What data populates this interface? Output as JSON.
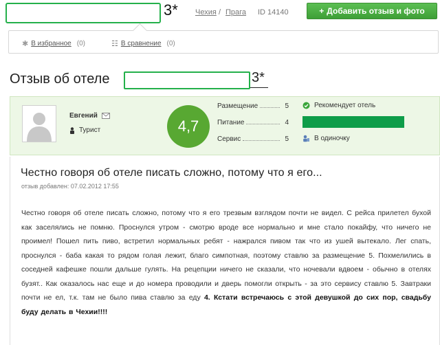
{
  "header": {
    "hotel_stars": "3*",
    "country": "Чехия",
    "separator": "/",
    "city": "Прага",
    "hotel_id": "ID 14140",
    "add_review_button": "Добавить отзыв и фото",
    "add_icon": "plus-icon"
  },
  "actions": {
    "favorites_label": "В избранное",
    "favorites_count": "(0)",
    "compare_label": "В сравнение",
    "compare_count": "(0)"
  },
  "title": {
    "prefix": "Отзыв об отеле",
    "stars": "3*"
  },
  "reviewer": {
    "name": "Евгений",
    "role": "Турист",
    "mail_icon": "envelope-icon",
    "role_icon": "person-icon",
    "avatar_icon": "user-silhouette-icon"
  },
  "score": "4,7",
  "ratings": [
    {
      "label": "Размещение",
      "value": "5"
    },
    {
      "label": "Питание",
      "value": "4"
    },
    {
      "label": "Сервис",
      "value": "5"
    }
  ],
  "recommend": "Рекомендует отель",
  "travel_type": "В одиночку",
  "colors": {
    "accent_green": "#58a832",
    "panel_bg": "#edf7e6",
    "highlight_bar": "#0e9d49"
  },
  "review": {
    "heading": "Честно говоря об отеле писать сложно, потому что я его...",
    "date": "отзыв добавлен: 07.02.2012 17:55",
    "body_before_bold": "Честно говоря об отеле писать сложно, потому что я его трезвым взглядом почти не видел. С рейса прилетел бухой как заселялись не помню. Проснулся утром - смотрю вроде все нормально и мне стало покайфу, что ничего не проимел! Пошел пить пиво, встретил нормальных ребят - нажрался пивом так что из ушей вытекало. Лег спать, проснулся - баба какая то рядом голая лежит, благо симпотная, поэтому ставлю за размещение 5. Похмелились в соседней кафешке пошли дальше гулять. На рецепции ничего не сказали, что ночевали вдвоем - обычно в отелях бузят.. Как оказалось нас еще и до номера проводили и дверь помогли открыть - за это сервису ставлю 5. Завтраки почти не ел, т.к. там не было пива ставлю за еду",
    "bold_text": "4. Кстати встречаюсь с этой девушкой до сих пор, свадьбу буду делать в Чехии!!!!"
  }
}
